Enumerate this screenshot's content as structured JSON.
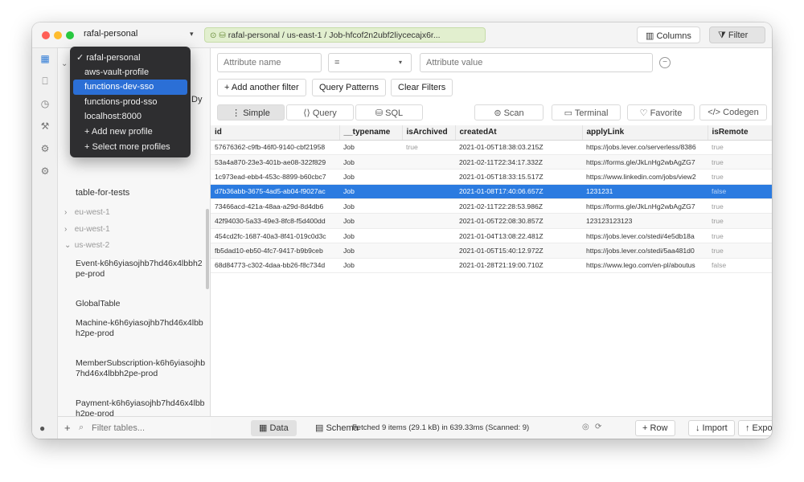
{
  "titlebar": {
    "profile": "rafal-personal",
    "breadcrumb": "rafal-personal / us-east-1 / Job-hfcof2n2ubf2liycecajx6r...",
    "columns_label": "Columns",
    "filter_label": "Filter"
  },
  "profile_menu": {
    "items": [
      {
        "label": "✓ rafal-personal"
      },
      {
        "label": "aws-vault-profile"
      },
      {
        "label": "functions-dev-sso"
      },
      {
        "label": "functions-prod-sso"
      },
      {
        "label": "localhost:8000"
      },
      {
        "label": "+ Add new profile"
      },
      {
        "label": "+ Select more profiles"
      }
    ],
    "selected_index": 2
  },
  "sidebar": {
    "hidden_fragment": "Dy",
    "top_table": "table-for-tests",
    "regions": [
      {
        "label": "eu-west-1",
        "chevron": "›"
      },
      {
        "label": "eu-west-1",
        "chevron": "›"
      },
      {
        "label": "us-west-2",
        "chevron": "⌄"
      }
    ],
    "tables": [
      "Event-k6h6yiasojhb7hd46x4lbbh2pe-prod",
      "GlobalTable",
      "Machine-k6h6yiasojhb7hd46x4lbbh2pe-prod",
      "MemberSubscription-k6h6yiasojhb7hd46x4lbbh2pe-prod",
      "Payment-k6h6yiasojhb7hd46x4lbbh2pe-prod"
    ],
    "filter_placeholder": "Filter tables..."
  },
  "filter": {
    "attribute_placeholder": "Attribute name",
    "operator": "=",
    "value_placeholder": "Attribute value"
  },
  "actions": {
    "add_filter": "+ Add another filter",
    "query_patterns": "Query Patterns",
    "clear_filters": "Clear Filters"
  },
  "modes": {
    "simple": "⋮ Simple",
    "query": "⟨⟩ Query",
    "sql": "⛁ SQL",
    "scan": "⊜ Scan",
    "terminal": "▭ Terminal",
    "favorite": "♡ Favorite",
    "codegen": "</> Codegen"
  },
  "table": {
    "columns": [
      "id",
      "__typename",
      "isArchived",
      "createdAt",
      "applyLink",
      "isRemote"
    ],
    "rows": [
      [
        "57676362-c9fb-46f0-9140-cbf21958",
        "Job",
        "true",
        "2021-01-05T18:38:03.215Z",
        "https://jobs.lever.co/serverless/8386",
        "true"
      ],
      [
        "53a4a870-23e3-401b-ae08-322f829",
        "Job",
        "",
        "2021-02-11T22:34:17.332Z",
        "https://forms.gle/JkLnHg2wbAgZG7",
        "true"
      ],
      [
        "1c973ead-ebb4-453c-8899-b60cbc7",
        "Job",
        "",
        "2021-01-05T18:33:15.517Z",
        "https://www.linkedin.com/jobs/view2",
        "true"
      ],
      [
        "d7b36abb-3675-4ad5-ab04-f9027ac",
        "Job",
        "",
        "2021-01-08T17:40:06.657Z",
        "1231231",
        "false"
      ],
      [
        "73466acd-421a-48aa-a29d-8d4db6",
        "Job",
        "",
        "2021-02-11T22:28:53.986Z",
        "https://forms.gle/JkLnHg2wbAgZG7",
        "true"
      ],
      [
        "42f94030-5a33-49e3-8fc8-f5d400dd",
        "Job",
        "",
        "2021-01-05T22:08:30.857Z",
        "123123123123",
        "true"
      ],
      [
        "454cd2fc-1687-40a3-8f41-019c0d3c",
        "Job",
        "",
        "2021-01-04T13:08:22.481Z",
        "https://jobs.lever.co/stedi/4e5db18a",
        "true"
      ],
      [
        "fb5dad10-eb50-4fc7-9417-b9b9ceb",
        "Job",
        "",
        "2021-01-05T15:40:12.972Z",
        "https://jobs.lever.co/stedi/5aa481d0",
        "true"
      ],
      [
        "68d84773-c302-4daa-bb26-f8c734d",
        "Job",
        "",
        "2021-01-28T21:19:00.710Z",
        "https://www.lego.com/en-pl/aboutus",
        "false"
      ]
    ],
    "selected_row": 3
  },
  "bottom": {
    "data_tab": "▦ Data",
    "schema_tab": "▤ Schema",
    "status": "Fetched 9 items (29.1 kB) in 639.33ms (Scanned: 9)",
    "add_row": "+ Row",
    "import": "↓ Import",
    "export": "↑ Export"
  }
}
